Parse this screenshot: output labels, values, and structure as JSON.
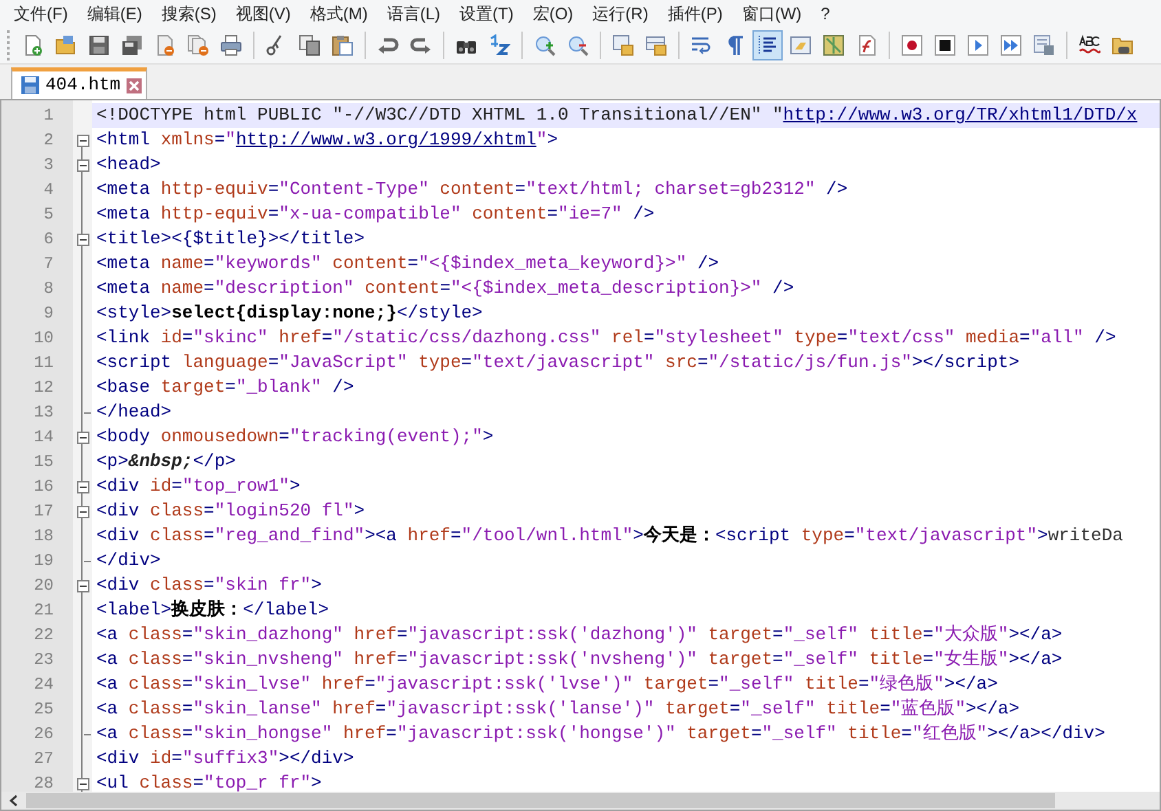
{
  "menu": [
    "文件(F)",
    "编辑(E)",
    "搜索(S)",
    "视图(V)",
    "格式(M)",
    "语言(L)",
    "设置(T)",
    "宏(O)",
    "运行(R)",
    "插件(P)",
    "窗口(W)",
    "?"
  ],
  "toolbar": [
    {
      "kind": "new",
      "selected": false
    },
    {
      "kind": "open",
      "selected": false
    },
    {
      "kind": "save",
      "selected": false
    },
    {
      "kind": "save-all",
      "selected": false
    },
    {
      "kind": "close",
      "selected": false
    },
    {
      "kind": "close-all",
      "selected": false
    },
    {
      "kind": "print",
      "selected": false
    },
    {
      "kind": "separator"
    },
    {
      "kind": "cut",
      "selected": false
    },
    {
      "kind": "copy",
      "selected": false
    },
    {
      "kind": "paste",
      "selected": false
    },
    {
      "kind": "separator"
    },
    {
      "kind": "undo",
      "selected": false
    },
    {
      "kind": "redo",
      "selected": false
    },
    {
      "kind": "separator"
    },
    {
      "kind": "find",
      "selected": false
    },
    {
      "kind": "replace",
      "selected": false
    },
    {
      "kind": "separator"
    },
    {
      "kind": "zoom-in",
      "selected": false
    },
    {
      "kind": "zoom-out",
      "selected": false
    },
    {
      "kind": "separator"
    },
    {
      "kind": "sync-v",
      "selected": false
    },
    {
      "kind": "sync-h",
      "selected": false
    },
    {
      "kind": "separator"
    },
    {
      "kind": "wrap",
      "selected": false
    },
    {
      "kind": "pilcrow",
      "selected": false
    },
    {
      "kind": "indent-guide",
      "selected": true
    },
    {
      "kind": "panel",
      "selected": false
    },
    {
      "kind": "map",
      "selected": false
    },
    {
      "kind": "function",
      "selected": false
    },
    {
      "kind": "separator"
    },
    {
      "kind": "record",
      "selected": false
    },
    {
      "kind": "stop",
      "selected": false
    },
    {
      "kind": "play",
      "selected": false
    },
    {
      "kind": "play-multi",
      "selected": false
    },
    {
      "kind": "save-macro",
      "selected": false
    },
    {
      "kind": "separator"
    },
    {
      "kind": "spell",
      "selected": false
    },
    {
      "kind": "folder",
      "selected": false
    }
  ],
  "tabs": [
    {
      "label": "404.htm",
      "selected": true
    }
  ],
  "editor": {
    "lines": [
      {
        "number": "1",
        "current": true,
        "fold_start": false,
        "fold_end": false,
        "tokens": [
          {
            "kind": "doctype",
            "text": "<!DOCTYPE html PUBLIC \"-//W3C//DTD XHTML 1.0 Transitional//EN\" \""
          },
          {
            "kind": "url",
            "text": "http://www.w3.org/TR/xhtml1/DTD/x"
          }
        ]
      },
      {
        "number": "2",
        "current": false,
        "fold_start": true,
        "fold_end": false,
        "tokens": [
          {
            "kind": "tag",
            "text": "<html"
          },
          {
            "kind": "attr",
            "text": " xmlns"
          },
          {
            "kind": "tag",
            "text": "="
          },
          {
            "kind": "value",
            "text": "\""
          },
          {
            "kind": "url",
            "text": "http://www.w3.org/1999/xhtml"
          },
          {
            "kind": "value",
            "text": "\""
          },
          {
            "kind": "tag",
            "text": ">"
          }
        ]
      },
      {
        "number": "3",
        "current": false,
        "fold_start": true,
        "fold_end": false,
        "tokens": [
          {
            "kind": "tag",
            "text": "<head>"
          }
        ]
      },
      {
        "number": "4",
        "current": false,
        "fold_start": false,
        "fold_end": false,
        "tokens": [
          {
            "kind": "tag",
            "text": "<meta"
          },
          {
            "kind": "attr",
            "text": " http-equiv"
          },
          {
            "kind": "tag",
            "text": "="
          },
          {
            "kind": "value",
            "text": "\"Content-Type\""
          },
          {
            "kind": "attr",
            "text": " content"
          },
          {
            "kind": "tag",
            "text": "="
          },
          {
            "kind": "value",
            "text": "\"text/html; charset=gb2312\""
          },
          {
            "kind": "tag",
            "text": " />"
          }
        ]
      },
      {
        "number": "5",
        "current": false,
        "fold_start": false,
        "fold_end": false,
        "tokens": [
          {
            "kind": "tag",
            "text": "<meta"
          },
          {
            "kind": "attr",
            "text": " http-equiv"
          },
          {
            "kind": "tag",
            "text": "="
          },
          {
            "kind": "value",
            "text": "\"x-ua-compatible\""
          },
          {
            "kind": "attr",
            "text": " content"
          },
          {
            "kind": "tag",
            "text": "="
          },
          {
            "kind": "value",
            "text": "\"ie=7\""
          },
          {
            "kind": "tag",
            "text": " />"
          }
        ]
      },
      {
        "number": "6",
        "current": false,
        "fold_start": true,
        "fold_end": false,
        "tokens": [
          {
            "kind": "tag",
            "text": "<title><{$title}></title>"
          }
        ]
      },
      {
        "number": "7",
        "current": false,
        "fold_start": false,
        "fold_end": false,
        "tokens": [
          {
            "kind": "tag",
            "text": "<meta"
          },
          {
            "kind": "attr",
            "text": " name"
          },
          {
            "kind": "tag",
            "text": "="
          },
          {
            "kind": "value",
            "text": "\"keywords\""
          },
          {
            "kind": "attr",
            "text": " content"
          },
          {
            "kind": "tag",
            "text": "="
          },
          {
            "kind": "value",
            "text": "\"<{$index_meta_keyword}>\""
          },
          {
            "kind": "tag",
            "text": " />"
          }
        ]
      },
      {
        "number": "8",
        "current": false,
        "fold_start": false,
        "fold_end": false,
        "tokens": [
          {
            "kind": "tag",
            "text": "<meta"
          },
          {
            "kind": "attr",
            "text": " name"
          },
          {
            "kind": "tag",
            "text": "="
          },
          {
            "kind": "value",
            "text": "\"description\""
          },
          {
            "kind": "attr",
            "text": " content"
          },
          {
            "kind": "tag",
            "text": "="
          },
          {
            "kind": "value",
            "text": "\"<{$index_meta_description}>\""
          },
          {
            "kind": "tag",
            "text": " />"
          }
        ]
      },
      {
        "number": "9",
        "current": false,
        "fold_start": false,
        "fold_end": false,
        "tokens": [
          {
            "kind": "tag",
            "text": "<style>"
          },
          {
            "kind": "text",
            "text": "select{display:none;}"
          },
          {
            "kind": "tag",
            "text": "</style>"
          }
        ]
      },
      {
        "number": "10",
        "current": false,
        "fold_start": false,
        "fold_end": false,
        "tokens": [
          {
            "kind": "tag",
            "text": "<link"
          },
          {
            "kind": "attr",
            "text": " id"
          },
          {
            "kind": "tag",
            "text": "="
          },
          {
            "kind": "value",
            "text": "\"skinc\""
          },
          {
            "kind": "attr",
            "text": " href"
          },
          {
            "kind": "tag",
            "text": "="
          },
          {
            "kind": "value",
            "text": "\"/static/css/dazhong.css\""
          },
          {
            "kind": "attr",
            "text": " rel"
          },
          {
            "kind": "tag",
            "text": "="
          },
          {
            "kind": "value",
            "text": "\"stylesheet\""
          },
          {
            "kind": "attr",
            "text": " type"
          },
          {
            "kind": "tag",
            "text": "="
          },
          {
            "kind": "value",
            "text": "\"text/css\""
          },
          {
            "kind": "attr",
            "text": " media"
          },
          {
            "kind": "tag",
            "text": "="
          },
          {
            "kind": "value",
            "text": "\"all\""
          },
          {
            "kind": "tag",
            "text": " />"
          }
        ]
      },
      {
        "number": "11",
        "current": false,
        "fold_start": false,
        "fold_end": false,
        "tokens": [
          {
            "kind": "tag",
            "text": "<script"
          },
          {
            "kind": "attr",
            "text": " language"
          },
          {
            "kind": "tag",
            "text": "="
          },
          {
            "kind": "value",
            "text": "\"JavaScript\""
          },
          {
            "kind": "attr",
            "text": " type"
          },
          {
            "kind": "tag",
            "text": "="
          },
          {
            "kind": "value",
            "text": "\"text/javascript\""
          },
          {
            "kind": "attr",
            "text": " src"
          },
          {
            "kind": "tag",
            "text": "="
          },
          {
            "kind": "value",
            "text": "\"/static/js/fun.js\""
          },
          {
            "kind": "tag",
            "text": "></script>"
          }
        ]
      },
      {
        "number": "12",
        "current": false,
        "fold_start": false,
        "fold_end": false,
        "tokens": [
          {
            "kind": "tag",
            "text": "<base"
          },
          {
            "kind": "attr",
            "text": " target"
          },
          {
            "kind": "tag",
            "text": "="
          },
          {
            "kind": "value",
            "text": "\"_blank\""
          },
          {
            "kind": "tag",
            "text": " />"
          }
        ]
      },
      {
        "number": "13",
        "current": false,
        "fold_start": false,
        "fold_end": true,
        "tokens": [
          {
            "kind": "tag",
            "text": "</head>"
          }
        ]
      },
      {
        "number": "14",
        "current": false,
        "fold_start": true,
        "fold_end": false,
        "tokens": [
          {
            "kind": "tag",
            "text": "<body"
          },
          {
            "kind": "attr",
            "text": " onmousedown"
          },
          {
            "kind": "tag",
            "text": "="
          },
          {
            "kind": "value",
            "text": "\"tracking(event);\""
          },
          {
            "kind": "tag",
            "text": ">"
          }
        ]
      },
      {
        "number": "15",
        "current": false,
        "fold_start": false,
        "fold_end": false,
        "tokens": [
          {
            "kind": "tag",
            "text": "<p>"
          },
          {
            "kind": "entity",
            "text": "&nbsp;"
          },
          {
            "kind": "tag",
            "text": "</p>"
          }
        ]
      },
      {
        "number": "16",
        "current": false,
        "fold_start": true,
        "fold_end": false,
        "tokens": [
          {
            "kind": "tag",
            "text": "<div"
          },
          {
            "kind": "attr",
            "text": " id"
          },
          {
            "kind": "tag",
            "text": "="
          },
          {
            "kind": "value",
            "text": "\"top_row1\""
          },
          {
            "kind": "tag",
            "text": ">"
          }
        ]
      },
      {
        "number": "17",
        "current": false,
        "fold_start": true,
        "fold_end": false,
        "tokens": [
          {
            "kind": "tag",
            "text": "<div"
          },
          {
            "kind": "attr",
            "text": " class"
          },
          {
            "kind": "tag",
            "text": "="
          },
          {
            "kind": "value",
            "text": "\"login520 fl\""
          },
          {
            "kind": "tag",
            "text": ">"
          }
        ]
      },
      {
        "number": "18",
        "current": false,
        "fold_start": false,
        "fold_end": false,
        "tokens": [
          {
            "kind": "tag",
            "text": "<div"
          },
          {
            "kind": "attr",
            "text": " class"
          },
          {
            "kind": "tag",
            "text": "="
          },
          {
            "kind": "value",
            "text": "\"reg_and_find\""
          },
          {
            "kind": "tag",
            "text": "><a"
          },
          {
            "kind": "attr",
            "text": " href"
          },
          {
            "kind": "tag",
            "text": "="
          },
          {
            "kind": "value",
            "text": "\"/tool/wnl.html\""
          },
          {
            "kind": "tag",
            "text": ">"
          },
          {
            "kind": "text",
            "text": "今天是："
          },
          {
            "kind": "tag",
            "text": "<script"
          },
          {
            "kind": "attr",
            "text": " type"
          },
          {
            "kind": "tag",
            "text": "="
          },
          {
            "kind": "value",
            "text": "\"text/javascript\""
          },
          {
            "kind": "tag",
            "text": ">"
          },
          {
            "kind": "script",
            "text": "writeDa"
          }
        ]
      },
      {
        "number": "19",
        "current": false,
        "fold_start": false,
        "fold_end": true,
        "tokens": [
          {
            "kind": "tag",
            "text": "</div>"
          }
        ]
      },
      {
        "number": "20",
        "current": false,
        "fold_start": true,
        "fold_end": false,
        "tokens": [
          {
            "kind": "tag",
            "text": "<div"
          },
          {
            "kind": "attr",
            "text": " class"
          },
          {
            "kind": "tag",
            "text": "="
          },
          {
            "kind": "value",
            "text": "\"skin fr\""
          },
          {
            "kind": "tag",
            "text": ">"
          }
        ]
      },
      {
        "number": "21",
        "current": false,
        "fold_start": false,
        "fold_end": false,
        "tokens": [
          {
            "kind": "tag",
            "text": "<label>"
          },
          {
            "kind": "text",
            "text": "换皮肤："
          },
          {
            "kind": "tag",
            "text": "</label>"
          }
        ]
      },
      {
        "number": "22",
        "current": false,
        "fold_start": false,
        "fold_end": false,
        "tokens": [
          {
            "kind": "tag",
            "text": "<a"
          },
          {
            "kind": "attr",
            "text": " class"
          },
          {
            "kind": "tag",
            "text": "="
          },
          {
            "kind": "value",
            "text": "\"skin_dazhong\""
          },
          {
            "kind": "attr",
            "text": " href"
          },
          {
            "kind": "tag",
            "text": "="
          },
          {
            "kind": "value",
            "text": "\"javascript:ssk('dazhong')\""
          },
          {
            "kind": "attr",
            "text": " target"
          },
          {
            "kind": "tag",
            "text": "="
          },
          {
            "kind": "value",
            "text": "\"_self\""
          },
          {
            "kind": "attr",
            "text": " title"
          },
          {
            "kind": "tag",
            "text": "="
          },
          {
            "kind": "value",
            "text": "\"大众版\""
          },
          {
            "kind": "tag",
            "text": "></a>"
          }
        ]
      },
      {
        "number": "23",
        "current": false,
        "fold_start": false,
        "fold_end": false,
        "tokens": [
          {
            "kind": "tag",
            "text": "<a"
          },
          {
            "kind": "attr",
            "text": " class"
          },
          {
            "kind": "tag",
            "text": "="
          },
          {
            "kind": "value",
            "text": "\"skin_nvsheng\""
          },
          {
            "kind": "attr",
            "text": " href"
          },
          {
            "kind": "tag",
            "text": "="
          },
          {
            "kind": "value",
            "text": "\"javascript:ssk('nvsheng')\""
          },
          {
            "kind": "attr",
            "text": " target"
          },
          {
            "kind": "tag",
            "text": "="
          },
          {
            "kind": "value",
            "text": "\"_self\""
          },
          {
            "kind": "attr",
            "text": " title"
          },
          {
            "kind": "tag",
            "text": "="
          },
          {
            "kind": "value",
            "text": "\"女生版\""
          },
          {
            "kind": "tag",
            "text": "></a>"
          }
        ]
      },
      {
        "number": "24",
        "current": false,
        "fold_start": false,
        "fold_end": false,
        "tokens": [
          {
            "kind": "tag",
            "text": "<a"
          },
          {
            "kind": "attr",
            "text": " class"
          },
          {
            "kind": "tag",
            "text": "="
          },
          {
            "kind": "value",
            "text": "\"skin_lvse\""
          },
          {
            "kind": "attr",
            "text": " href"
          },
          {
            "kind": "tag",
            "text": "="
          },
          {
            "kind": "value",
            "text": "\"javascript:ssk('lvse')\""
          },
          {
            "kind": "attr",
            "text": " target"
          },
          {
            "kind": "tag",
            "text": "="
          },
          {
            "kind": "value",
            "text": "\"_self\""
          },
          {
            "kind": "attr",
            "text": " title"
          },
          {
            "kind": "tag",
            "text": "="
          },
          {
            "kind": "value",
            "text": "\"绿色版\""
          },
          {
            "kind": "tag",
            "text": "></a>"
          }
        ]
      },
      {
        "number": "25",
        "current": false,
        "fold_start": false,
        "fold_end": false,
        "tokens": [
          {
            "kind": "tag",
            "text": "<a"
          },
          {
            "kind": "attr",
            "text": " class"
          },
          {
            "kind": "tag",
            "text": "="
          },
          {
            "kind": "value",
            "text": "\"skin_lanse\""
          },
          {
            "kind": "attr",
            "text": " href"
          },
          {
            "kind": "tag",
            "text": "="
          },
          {
            "kind": "value",
            "text": "\"javascript:ssk('lanse')\""
          },
          {
            "kind": "attr",
            "text": " target"
          },
          {
            "kind": "tag",
            "text": "="
          },
          {
            "kind": "value",
            "text": "\"_self\""
          },
          {
            "kind": "attr",
            "text": " title"
          },
          {
            "kind": "tag",
            "text": "="
          },
          {
            "kind": "value",
            "text": "\"蓝色版\""
          },
          {
            "kind": "tag",
            "text": "></a>"
          }
        ]
      },
      {
        "number": "26",
        "current": false,
        "fold_start": false,
        "fold_end": true,
        "tokens": [
          {
            "kind": "tag",
            "text": "<a"
          },
          {
            "kind": "attr",
            "text": " class"
          },
          {
            "kind": "tag",
            "text": "="
          },
          {
            "kind": "value",
            "text": "\"skin_hongse\""
          },
          {
            "kind": "attr",
            "text": " href"
          },
          {
            "kind": "tag",
            "text": "="
          },
          {
            "kind": "value",
            "text": "\"javascript:ssk('hongse')\""
          },
          {
            "kind": "attr",
            "text": " target"
          },
          {
            "kind": "tag",
            "text": "="
          },
          {
            "kind": "value",
            "text": "\"_self\""
          },
          {
            "kind": "attr",
            "text": " title"
          },
          {
            "kind": "tag",
            "text": "="
          },
          {
            "kind": "value",
            "text": "\"红色版\""
          },
          {
            "kind": "tag",
            "text": "></a></div>"
          }
        ]
      },
      {
        "number": "27",
        "current": false,
        "fold_start": false,
        "fold_end": false,
        "tokens": [
          {
            "kind": "tag",
            "text": "<div"
          },
          {
            "kind": "attr",
            "text": " id"
          },
          {
            "kind": "tag",
            "text": "="
          },
          {
            "kind": "value",
            "text": "\"suffix3\""
          },
          {
            "kind": "tag",
            "text": "></div>"
          }
        ]
      },
      {
        "number": "28",
        "current": false,
        "fold_start": true,
        "fold_end": false,
        "tokens": [
          {
            "kind": "tag",
            "text": "<ul"
          },
          {
            "kind": "attr",
            "text": " class"
          },
          {
            "kind": "tag",
            "text": "="
          },
          {
            "kind": "value",
            "text": "\"top_r fr\""
          },
          {
            "kind": "tag",
            "text": ">"
          }
        ]
      }
    ]
  }
}
